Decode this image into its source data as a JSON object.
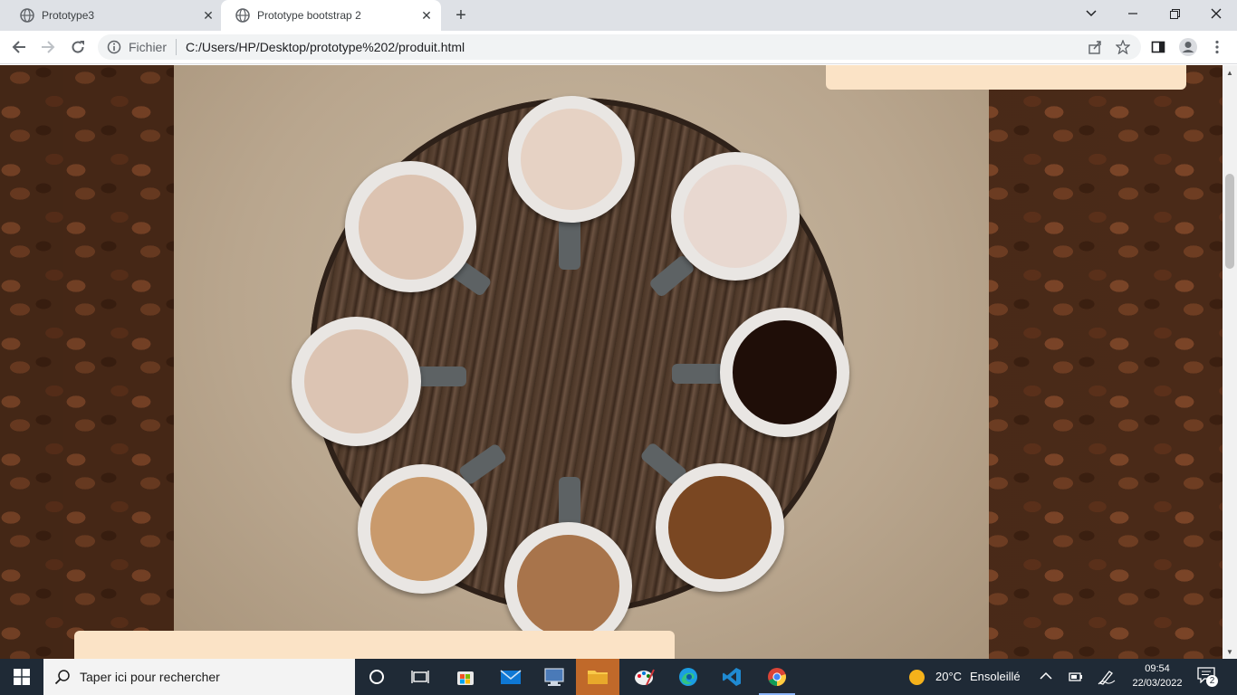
{
  "browser": {
    "tabs": [
      {
        "title": "Prototype3",
        "icon": "globe-icon",
        "active": false
      },
      {
        "title": "Prototype bootstrap 2",
        "icon": "globe-icon",
        "active": true
      }
    ],
    "omnibox": {
      "security_label": "Fichier",
      "url": "C:/Users/HP/Desktop/prototype%202/produit.html"
    }
  },
  "page": {
    "hero_image": "coffee-cups-on-wooden-table",
    "background_image": "coffee-beans",
    "card_color": "#fbe3c6"
  },
  "taskbar": {
    "search_placeholder": "Taper ici pour rechercher",
    "weather": {
      "temperature": "20°C",
      "condition": "Ensoleillé"
    },
    "time": "09:54",
    "date": "22/03/2022",
    "notifications_count": "2"
  }
}
